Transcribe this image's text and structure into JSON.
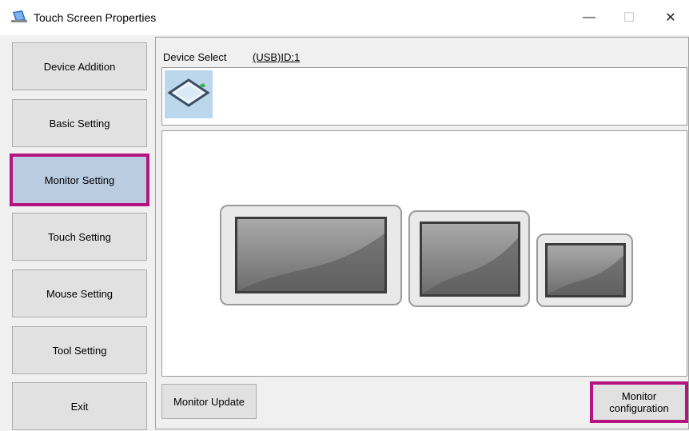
{
  "window": {
    "title": "Touch Screen Properties",
    "minimize_glyph": "—",
    "maximize_glyph": "☐",
    "close_glyph": "✕"
  },
  "sidebar": {
    "items": [
      {
        "label": "Device Addition"
      },
      {
        "label": "Basic Setting"
      },
      {
        "label": "Monitor Setting",
        "active": true
      },
      {
        "label": "Touch Setting"
      },
      {
        "label": "Mouse Setting"
      },
      {
        "label": "Tool Setting"
      },
      {
        "label": "Exit"
      }
    ]
  },
  "device": {
    "select_label": "Device Select",
    "selected_id": "(USB)ID:1"
  },
  "monitors": {
    "count": 3
  },
  "buttons": {
    "monitor_update": "Monitor Update",
    "monitor_configuration": "Monitor\nconfiguration"
  },
  "colors": {
    "highlight": "#b5137f",
    "active_tab": "#b9cce0"
  }
}
